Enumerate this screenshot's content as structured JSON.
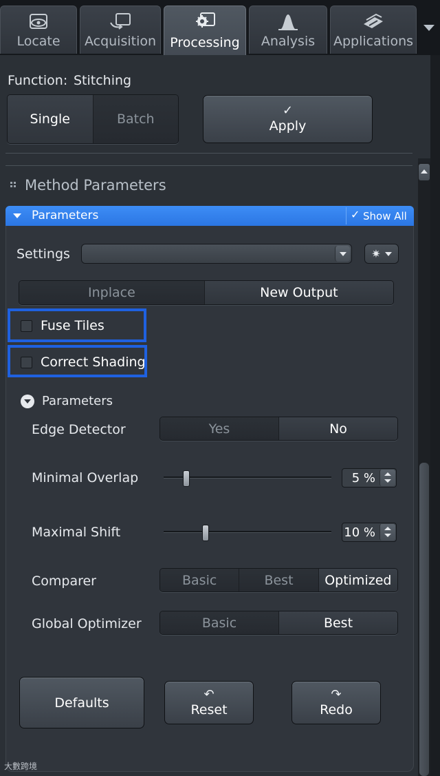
{
  "tabs": [
    {
      "label": "Locate",
      "icon": "eye-icon",
      "active": false
    },
    {
      "label": "Acquisition",
      "icon": "camera-arrow-icon",
      "active": false
    },
    {
      "label": "Processing",
      "icon": "gear-icon",
      "active": true
    },
    {
      "label": "Analysis",
      "icon": "histogram-icon",
      "active": false
    },
    {
      "label": "Applications",
      "icon": "stack-icon",
      "active": false
    }
  ],
  "function": {
    "label": "Function:",
    "value": "Stitching"
  },
  "mode": {
    "options": [
      "Single",
      "Batch"
    ],
    "selected": "Single"
  },
  "apply": {
    "label": "Apply",
    "icon": "checkmark-icon"
  },
  "method": {
    "title": "Method Parameters"
  },
  "params_panel": {
    "title": "Parameters",
    "show_all": "Show All"
  },
  "settings": {
    "label": "Settings",
    "value": ""
  },
  "output": {
    "options": [
      "Inplace",
      "New Output"
    ],
    "selected": "New Output"
  },
  "checkboxes": {
    "fuse_tiles": {
      "label": "Fuse Tiles",
      "checked": false
    },
    "correct_shading": {
      "label": "Correct Shading",
      "checked": false
    }
  },
  "sub_params": {
    "title": "Parameters"
  },
  "edge_detector": {
    "label": "Edge Detector",
    "options": [
      "Yes",
      "No"
    ],
    "selected": "No"
  },
  "minimal_overlap": {
    "label": "Minimal Overlap",
    "value": "5 %",
    "level": 0.12
  },
  "maximal_shift": {
    "label": "Maximal Shift",
    "value": "10 %",
    "level": 0.24
  },
  "comparer": {
    "label": "Comparer",
    "options": [
      "Basic",
      "Best",
      "Optimized"
    ],
    "selected": "Optimized"
  },
  "global_optimizer": {
    "label": "Global Optimizer",
    "options": [
      "Basic",
      "Best"
    ],
    "selected": "Best"
  },
  "buttons": {
    "defaults": {
      "label": "Defaults"
    },
    "reset": {
      "label": "Reset",
      "icon": "undo-icon"
    },
    "redo": {
      "label": "Redo",
      "icon": "redo-icon"
    }
  },
  "watermark": "大數跨境",
  "colors": {
    "accent": "#2b76e3",
    "highlight": "#1f61e0",
    "panel": "#30353c"
  }
}
